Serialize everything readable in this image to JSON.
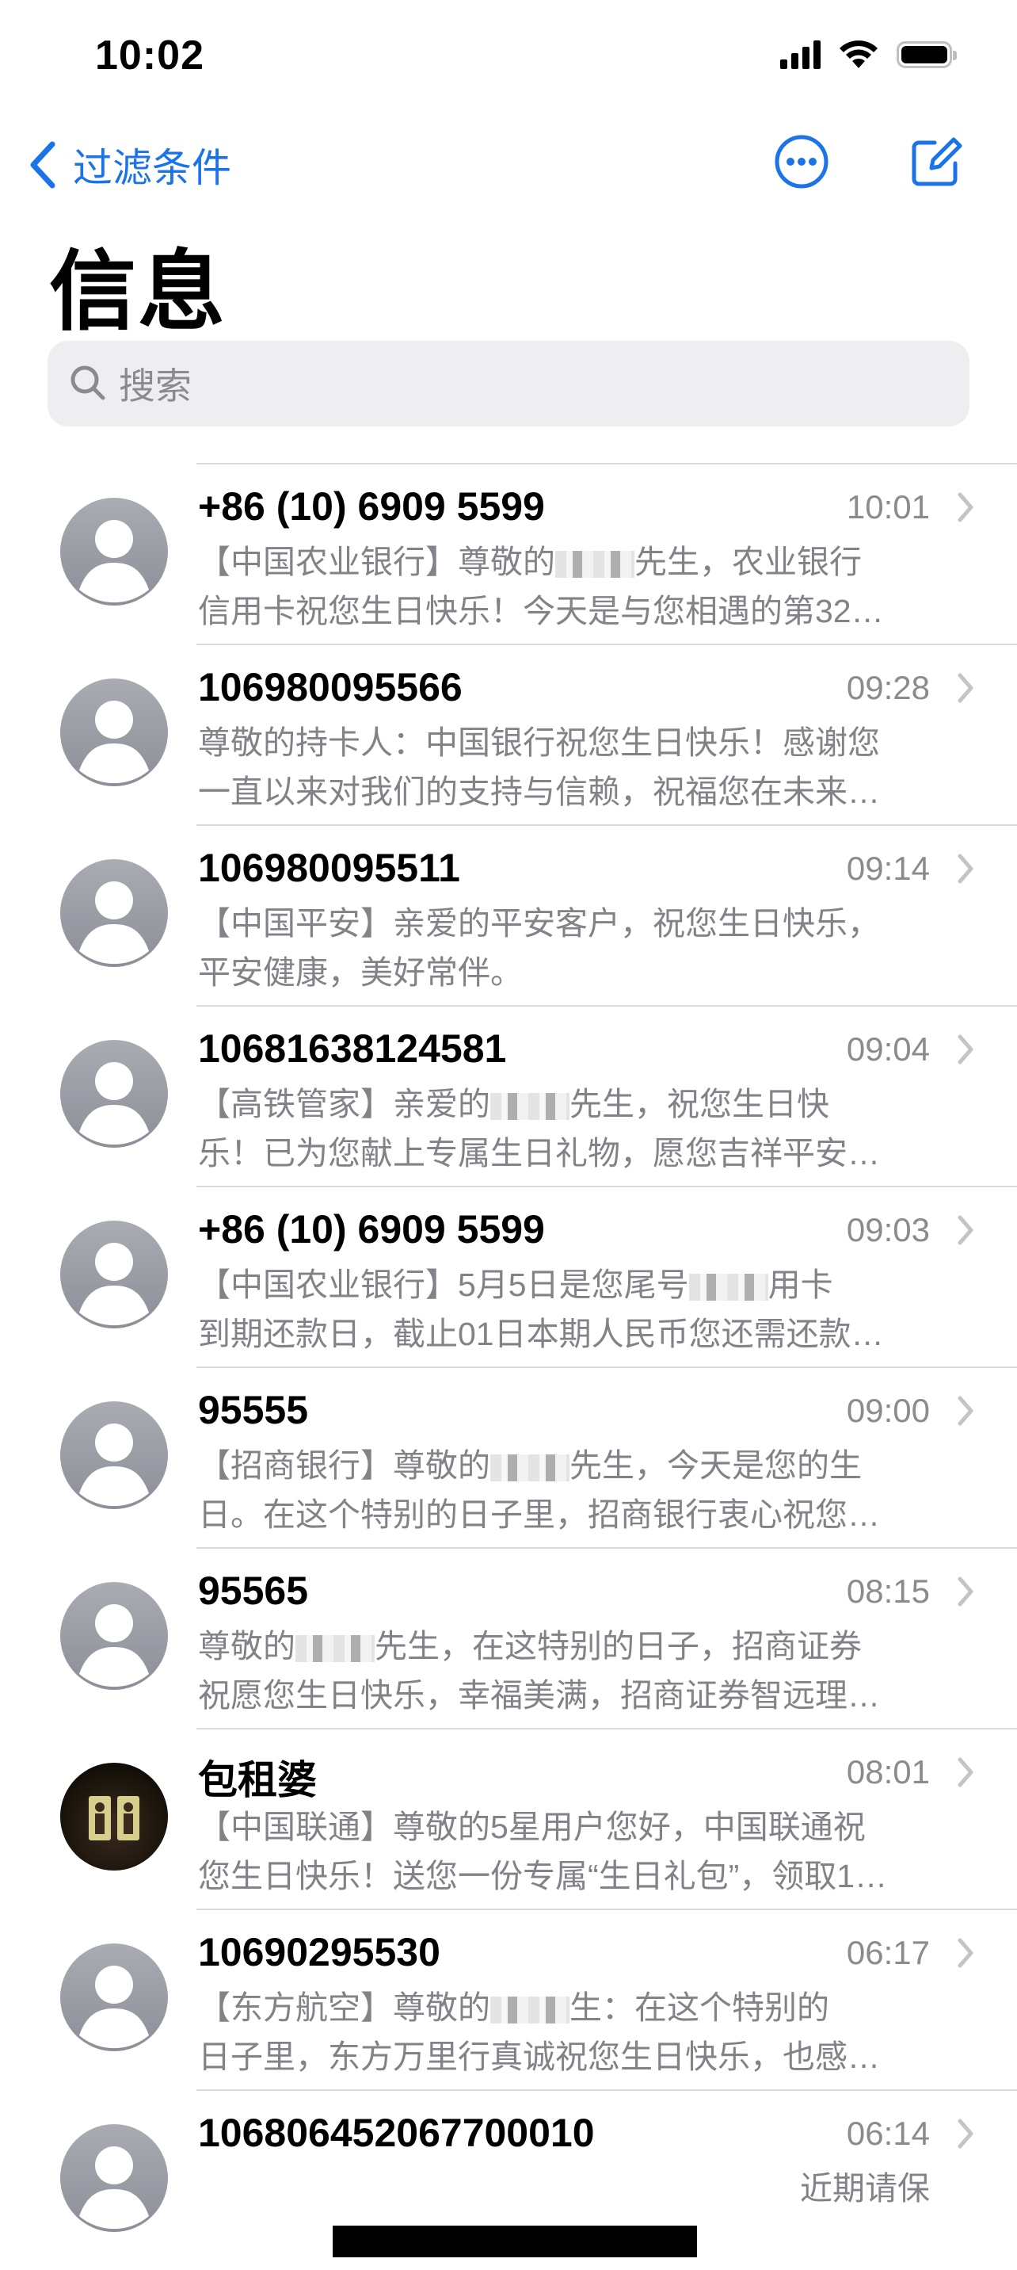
{
  "status": {
    "time": "10:02"
  },
  "nav": {
    "back_label": "过滤条件"
  },
  "title": "信息",
  "search": {
    "placeholder": "搜索"
  },
  "messages": [
    {
      "name": "+86 (10) 6909 5599",
      "time": "10:01",
      "line1a": "【中国农业银行】尊敬的",
      "line1b": "先生，农业银行",
      "line2": "信用卡祝您生日快乐！今天是与您相遇的第32…",
      "avatar": "person-icon"
    },
    {
      "name": "106980095566",
      "time": "09:28",
      "line1a": "尊敬的持卡人：中国银行祝您生日快乐！感谢您",
      "line1b": "",
      "line2": "一直以来对我们的支持与信赖，祝福您在未来…",
      "avatar": "person-icon"
    },
    {
      "name": "106980095511",
      "time": "09:14",
      "line1a": "【中国平安】亲爱的平安客户，祝您生日快乐，",
      "line1b": "",
      "line2": "平安健康，美好常伴。",
      "avatar": "person-icon"
    },
    {
      "name": "10681638124581",
      "time": "09:04",
      "line1a": "【高铁管家】亲爱的",
      "line1b": "先生，祝您生日快",
      "line2": "乐！已为您献上专属生日礼物，愿您吉祥平安…",
      "avatar": "person-icon"
    },
    {
      "name": "+86 (10) 6909 5599",
      "time": "09:03",
      "line1a": "【中国农业银行】5月5日是您尾号",
      "line1b": "用卡",
      "line2": "到期还款日，截止01日本期人民币您还需还款…",
      "avatar": "person-icon"
    },
    {
      "name": "95555",
      "time": "09:00",
      "line1a": "【招商银行】尊敬的",
      "line1b": "先生，今天是您的生",
      "line2": "日。在这个特别的日子里，招商银行衷心祝您…",
      "avatar": "person-icon"
    },
    {
      "name": "95565",
      "time": "08:15",
      "line1a": "尊敬的",
      "line1b": "先生，在这特别的日子，招商证券",
      "line2": "祝愿您生日快乐，幸福美满，招商证券智远理…",
      "avatar": "person-icon"
    },
    {
      "name": "包租婆",
      "time": "08:01",
      "line1a": "【中国联通】尊敬的5星用户您好，中国联通祝",
      "line1b": "",
      "line2": "您生日快乐！送您一份专属“生日礼包”，领取1…",
      "avatar": "photo-avatar"
    },
    {
      "name": "10690295530",
      "time": "06:17",
      "line1a": "【东方航空】尊敬的",
      "line1b": "生：在这个特别的",
      "line2": "日子里，东方万里行真诚祝您生日快乐，也感…",
      "avatar": "person-icon"
    },
    {
      "name": "106806452067700010",
      "time": "06:14",
      "line1a": "",
      "line1b": "近期请保",
      "line2": "",
      "avatar": "person-icon"
    }
  ]
}
